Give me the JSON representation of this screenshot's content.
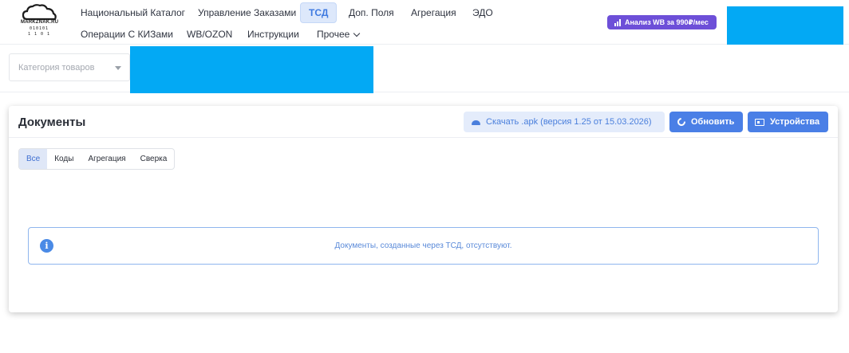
{
  "header": {
    "logo": {
      "text": "MARKZNAK.RU",
      "bits_top": "010101",
      "bits_bottom": "1 1 0 1"
    },
    "nav_row1": [
      "Национальный Каталог",
      "Управление Заказами",
      "ТСД",
      "Доп. Поля",
      "Агрегация",
      "ЭДО"
    ],
    "nav_row2": [
      "Операции С КИЗами",
      "WB/OZON",
      "Инструкции",
      "Прочее"
    ],
    "active_item": "ТСД",
    "promo_label": "Анализ WB за 990₽/мес",
    "promo_color": "#6d4fd8"
  },
  "filters": {
    "category_placeholder": "Категория товаров"
  },
  "documents": {
    "title": "Документы",
    "download_apk_label": "Скачать .apk (версия 1.25 от 15.03.2026)",
    "refresh_label": "Обновить",
    "devices_label": "Устройства",
    "tabs": [
      "Все",
      "Коды",
      "Агрегация",
      "Сверка"
    ],
    "active_tab": "Все",
    "empty_message": "Документы, созданные через ТСД, отсутствуют."
  },
  "colors": {
    "accent": "#4a7fe6",
    "redaction": "#03a9f4"
  }
}
